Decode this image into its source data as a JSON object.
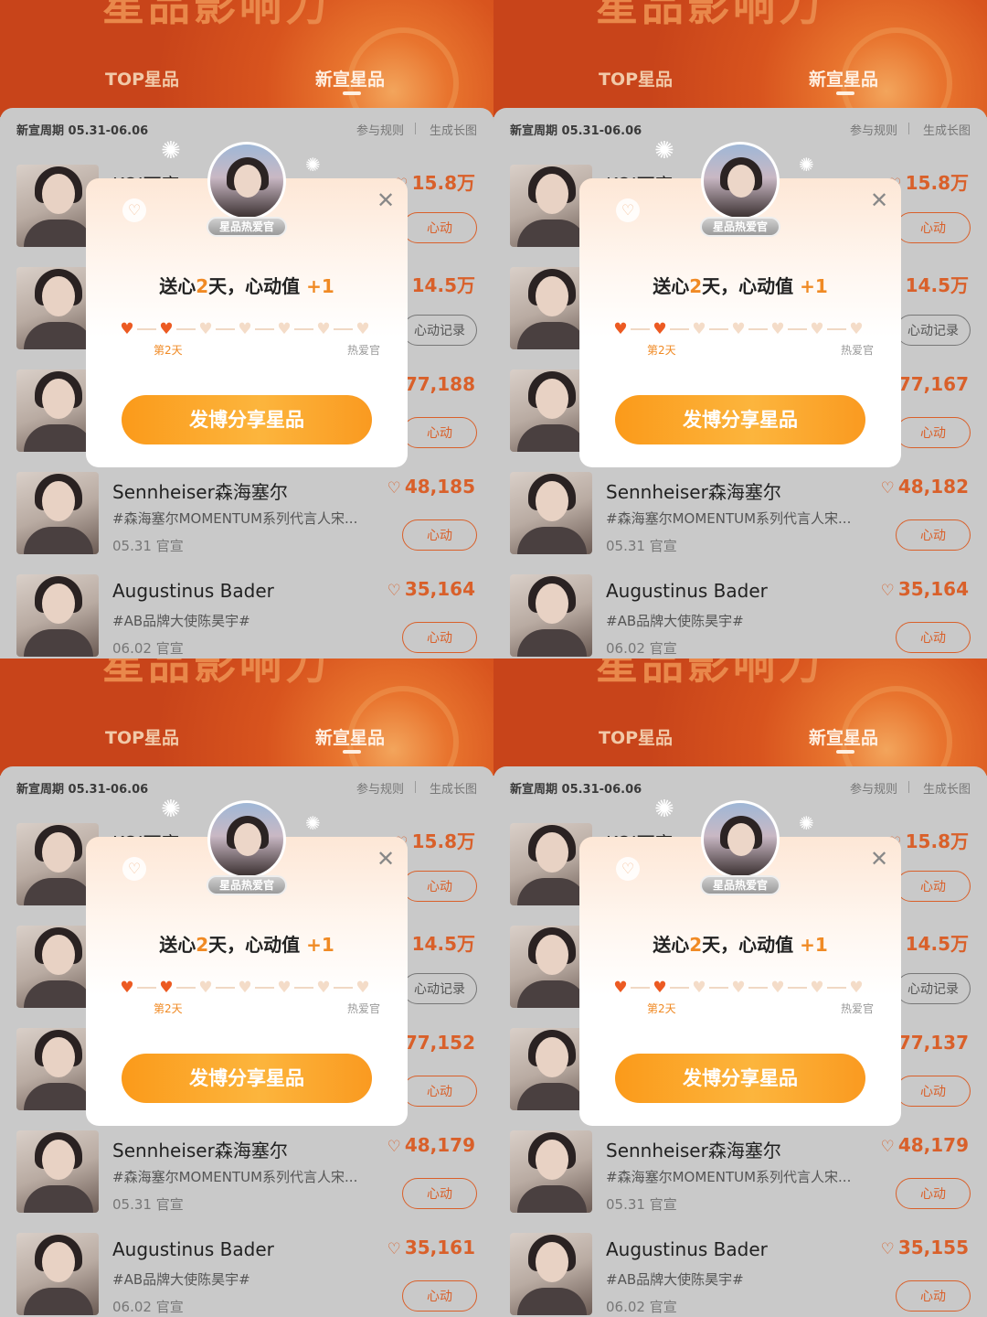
{
  "header": {
    "banner_text": "星品影响力",
    "tabs": [
      {
        "label": "TOP星品"
      },
      {
        "label": "新宣星品"
      }
    ]
  },
  "toolbar": {
    "cycle": "新宣周期 05.31-06.06",
    "rules": "参与规则",
    "long_image": "生成长图"
  },
  "popup": {
    "badge": "星品热爱官",
    "title_prefix": "送心",
    "title_days": "2",
    "title_mid": "天，心动值",
    "title_plus": "+1",
    "progress_start": "第2天",
    "progress_end": "热爱官",
    "progress_filled": 2,
    "progress_total": 7,
    "cta": "发博分享星品"
  },
  "icons": {
    "heart": "heart-icon",
    "close": "close-icon",
    "sparkle": "sparkle-icon"
  },
  "colors": {
    "accent": "#d9602a",
    "cta": "#fcb53d",
    "highlight": "#f08a24"
  },
  "screens": [
    {
      "rows": [
        {
          "name": "KOI可宣",
          "count": "15.8万",
          "btn": "心动"
        },
        {
          "name": "",
          "count": "14.5万",
          "btn": "心动记录",
          "filled": true
        },
        {
          "name": "",
          "count": "77,188",
          "btn": "心动"
        },
        {
          "name": "Sennheiser森海塞尔",
          "desc": "#森海塞尔MOMENTUM系列代言人宋...",
          "date": "05.31 官宣",
          "count": "48,185",
          "btn": "心动"
        },
        {
          "name": "Augustinus Bader",
          "desc": "#AB品牌大使陈昊宇#",
          "date": "06.02 官宣",
          "count": "35,164",
          "btn": "心动"
        }
      ]
    },
    {
      "rows": [
        {
          "name": "KOI可宣",
          "count": "15.8万",
          "btn": "心动"
        },
        {
          "name": "",
          "count": "14.5万",
          "btn": "心动记录",
          "filled": true
        },
        {
          "name": "",
          "count": "77,167",
          "btn": "心动"
        },
        {
          "name": "Sennheiser森海塞尔",
          "desc": "#森海塞尔MOMENTUM系列代言人宋...",
          "date": "05.31 官宣",
          "count": "48,182",
          "btn": "心动"
        },
        {
          "name": "Augustinus Bader",
          "desc": "#AB品牌大使陈昊宇#",
          "date": "06.02 官宣",
          "count": "35,164",
          "btn": "心动"
        }
      ]
    },
    {
      "rows": [
        {
          "name": "KOI可宣",
          "count": "15.8万",
          "btn": "心动"
        },
        {
          "name": "",
          "count": "14.5万",
          "btn": "心动记录",
          "filled": true
        },
        {
          "name": "",
          "count": "77,152",
          "btn": "心动"
        },
        {
          "name": "Sennheiser森海塞尔",
          "desc": "#森海塞尔MOMENTUM系列代言人宋...",
          "date": "05.31 官宣",
          "count": "48,179",
          "btn": "心动"
        },
        {
          "name": "Augustinus Bader",
          "desc": "#AB品牌大使陈昊宇#",
          "date": "06.02 官宣",
          "count": "35,161",
          "btn": "心动"
        }
      ]
    },
    {
      "rows": [
        {
          "name": "KOI可宣",
          "count": "15.8万",
          "btn": "心动"
        },
        {
          "name": "",
          "count": "14.5万",
          "btn": "心动记录",
          "filled": true
        },
        {
          "name": "",
          "count": "77,137",
          "btn": "心动"
        },
        {
          "name": "Sennheiser森海塞尔",
          "desc": "#森海塞尔MOMENTUM系列代言人宋...",
          "date": "05.31 官宣",
          "count": "48,179",
          "btn": "心动"
        },
        {
          "name": "Augustinus Bader",
          "desc": "#AB品牌大使陈昊宇#",
          "date": "06.02 官宣",
          "count": "35,155",
          "btn": "心动"
        }
      ]
    }
  ]
}
